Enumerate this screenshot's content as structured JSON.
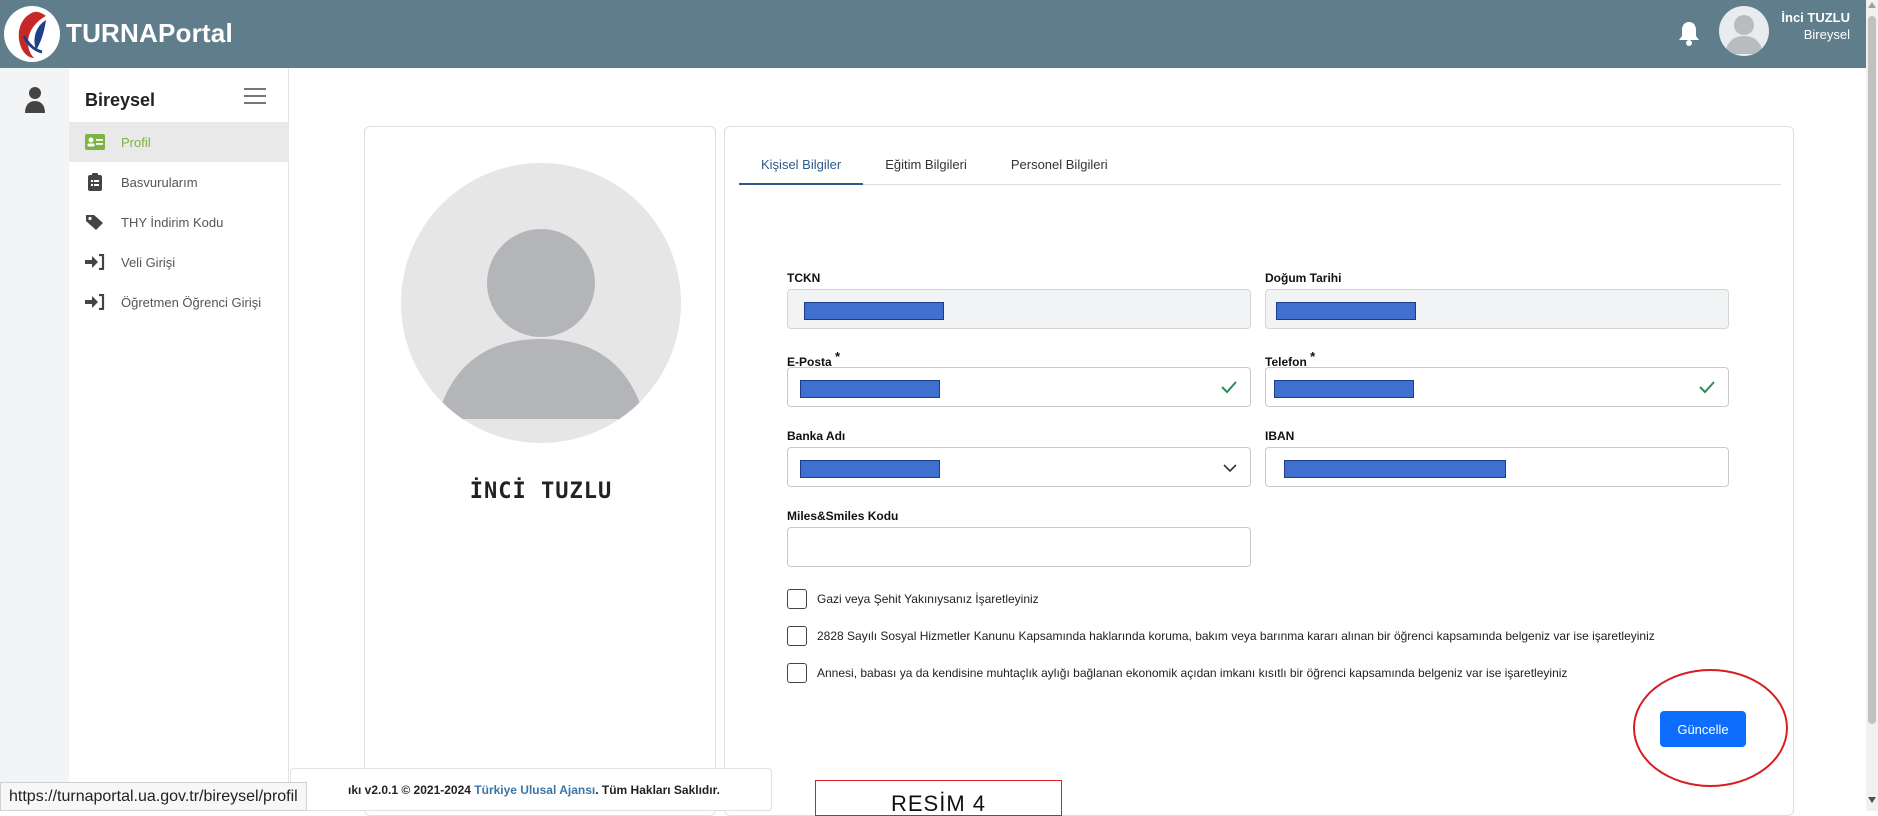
{
  "app": {
    "brand": "TURNAPortal"
  },
  "topbar": {
    "user_name": "İnci TUZLU",
    "user_role": "Bireysel",
    "color": "#5f7d8b"
  },
  "sidebar": {
    "title": "Bireysel",
    "items": [
      {
        "label": "Profil",
        "icon": "id-card-icon",
        "active": true
      },
      {
        "label": "Basvurularım",
        "icon": "clipboard-list-icon",
        "active": false
      },
      {
        "label": "THY İndirim Kodu",
        "icon": "tag-icon",
        "active": false
      },
      {
        "label": "Veli Girişi",
        "icon": "sign-in-icon",
        "active": false
      },
      {
        "label": "Öğretmen Öğrenci Girişi",
        "icon": "sign-in-icon",
        "active": false
      }
    ]
  },
  "profile": {
    "name": "İNCİ TUZLU"
  },
  "tabs": [
    {
      "label": "Kişisel Bilgiler",
      "active": true
    },
    {
      "label": "Eğitim Bilgileri",
      "active": false
    },
    {
      "label": "Personel Bilgileri",
      "active": false
    }
  ],
  "form": {
    "tckn_label": "TCKN",
    "dogum_label": "Doğum Tarihi",
    "eposta_label": "E-Posta",
    "telefon_label": "Telefon",
    "required_mark": "*",
    "banka_label": "Banka Adı",
    "iban_label": "IBAN",
    "miles_label": "Miles&Smiles Kodu",
    "miles_value": ""
  },
  "checkboxes": [
    {
      "label": "Gazi veya Şehit Yakınıysanız İşaretleyiniz",
      "checked": false
    },
    {
      "label": "2828 Sayılı Sosyal Hizmetler Kanunu Kapsamında haklarında koruma, bakım veya barınma kararı alınan bir öğrenci kapsamında belgeniz var ise işaretleyiniz",
      "checked": false
    },
    {
      "label": "Annesi, babası ya da kendisine muhtaçlık aylığı bağlanan ekonomik açıdan imkanı kısıtlı bir öğrenci kapsamında belgeniz var ise işaretleyiniz",
      "checked": false
    }
  ],
  "actions": {
    "update_label": "Güncelle",
    "accent": "#0d6efd"
  },
  "footer": {
    "prefix": "ıkı v2.0.1 © 2021-2024 ",
    "org": "Türkiye Ulusal Ajansı",
    "suffix": ". Tüm Hakları Saklıdır."
  },
  "status_url": "https://turnaportal.ua.gov.tr/bireysel/profil",
  "annotation": "RESİM 4"
}
